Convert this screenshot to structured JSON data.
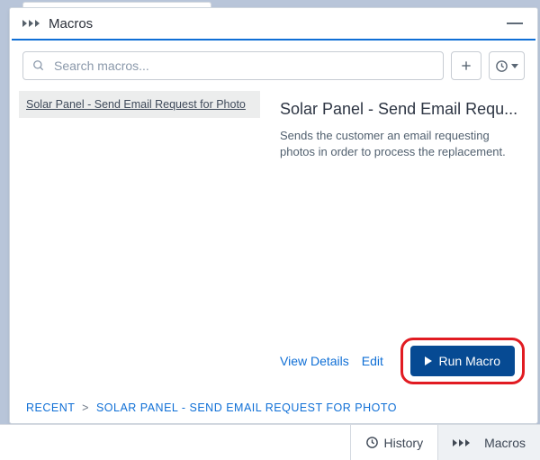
{
  "panel": {
    "title": "Macros"
  },
  "search": {
    "placeholder": "Search macros..."
  },
  "list": {
    "items": [
      {
        "label": "Solar Panel - Send Email Request for Photo"
      }
    ]
  },
  "detail": {
    "title": "Solar Panel - Send Email Requ...",
    "description": "Sends the customer an email requesting photos in order to process the replacement.",
    "view_details_label": "View Details",
    "edit_label": "Edit",
    "run_label": "Run Macro"
  },
  "breadcrumb": {
    "root": "Recent",
    "current": "Solar Panel - Send Email Request for Photo"
  },
  "footer": {
    "history_label": "History",
    "macros_label": "Macros"
  }
}
